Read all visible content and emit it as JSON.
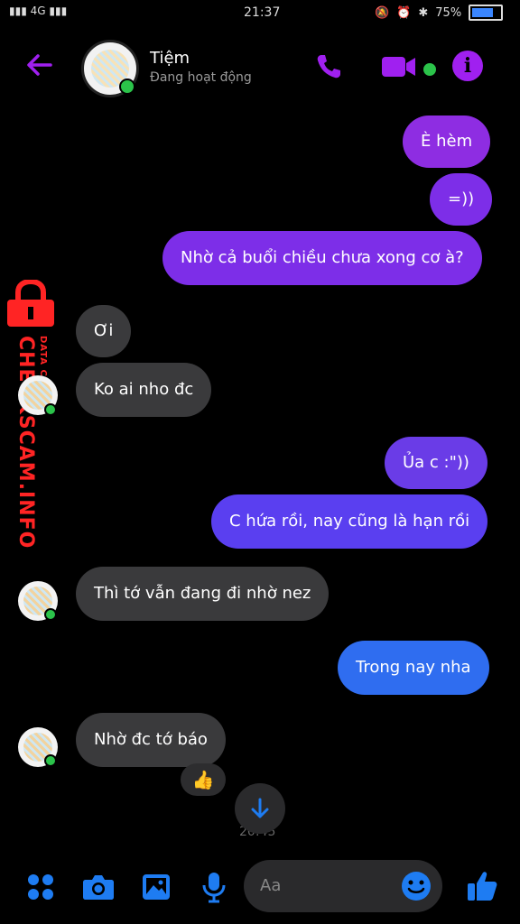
{
  "status_bar": {
    "time": "21:37",
    "signal": "4G",
    "battery_text": "75%",
    "battery_level_percent": 75
  },
  "header": {
    "contact_name": "Tiệm",
    "contact_status": "Đang hoạt động"
  },
  "messages": [
    {
      "text": "È hèm",
      "side": "outgoing"
    },
    {
      "text": "=))",
      "side": "outgoing"
    },
    {
      "text": "Nhờ cả buổi chiều chưa xong cơ à?",
      "side": "outgoing"
    },
    {
      "text": "Ơi",
      "side": "incoming"
    },
    {
      "text": "Ko ai nho đc",
      "side": "incoming"
    },
    {
      "text": "Ủa c :\"))",
      "side": "outgoing"
    },
    {
      "text": "C hứa rồi,  nay cũng là hạn rồi",
      "side": "outgoing"
    },
    {
      "text": "Thì tớ vẫn đang đi nhờ nez",
      "side": "incoming"
    },
    {
      "text": "Trong nay nha",
      "side": "outgoing"
    },
    {
      "text": "Nhờ đc tớ báo",
      "side": "incoming"
    }
  ],
  "reaction": "👍",
  "timestamp_divider": "20:45",
  "watermark": {
    "main": "CHECKSCAM.INFO",
    "sub": "DATA CENTER"
  },
  "composer": {
    "placeholder": "Aa"
  },
  "icons": {
    "back": "arrow-left-icon",
    "call": "phone-icon",
    "video": "video-camera-icon",
    "info": "info-icon",
    "menu": "grid-dots-icon",
    "camera": "camera-icon",
    "gallery": "image-icon",
    "mic": "microphone-icon",
    "emoji": "smiley-icon",
    "like": "thumbs-up-icon",
    "scroll": "arrow-down-icon"
  },
  "colors": {
    "accent_purple": "#a020f0",
    "accent_blue": "#1e7cf2",
    "online_green": "#2bc34a"
  }
}
